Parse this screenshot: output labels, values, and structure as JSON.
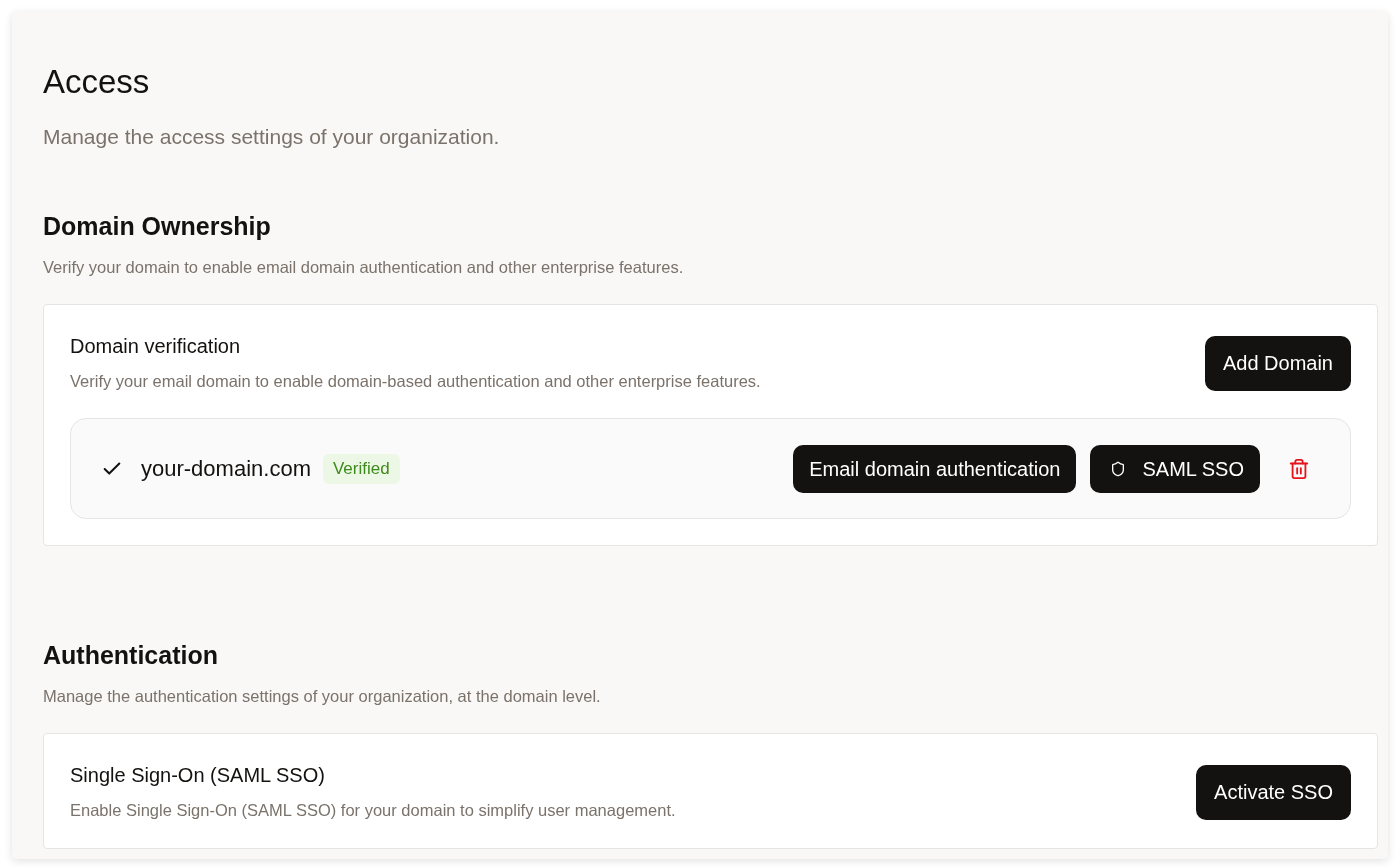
{
  "page": {
    "title": "Access",
    "subtitle": "Manage the access settings of your organization."
  },
  "sections": [
    {
      "heading": "Domain Ownership",
      "description": "Verify your domain to enable email domain authentication and other enterprise features.",
      "card": {
        "title": "Domain verification",
        "description": "Verify your email domain to enable domain-based authentication and other enterprise features.",
        "action": "Add Domain",
        "domains": [
          {
            "name": "your-domain.com",
            "verified": true,
            "status": "Verified",
            "actions": [
              {
                "kind": "plain",
                "label": "Email domain authentication"
              },
              {
                "kind": "shield",
                "label": "SAML SSO"
              }
            ],
            "deletable": true
          }
        ]
      }
    },
    {
      "heading": "Authentication",
      "description": "Manage the authentication settings of your organization, at the domain level.",
      "card": {
        "title": "Single Sign-On (SAML SSO)",
        "description": "Enable Single Sign-On (SAML SSO) for your domain to simplify user management.",
        "action": "Activate SSO"
      }
    }
  ]
}
